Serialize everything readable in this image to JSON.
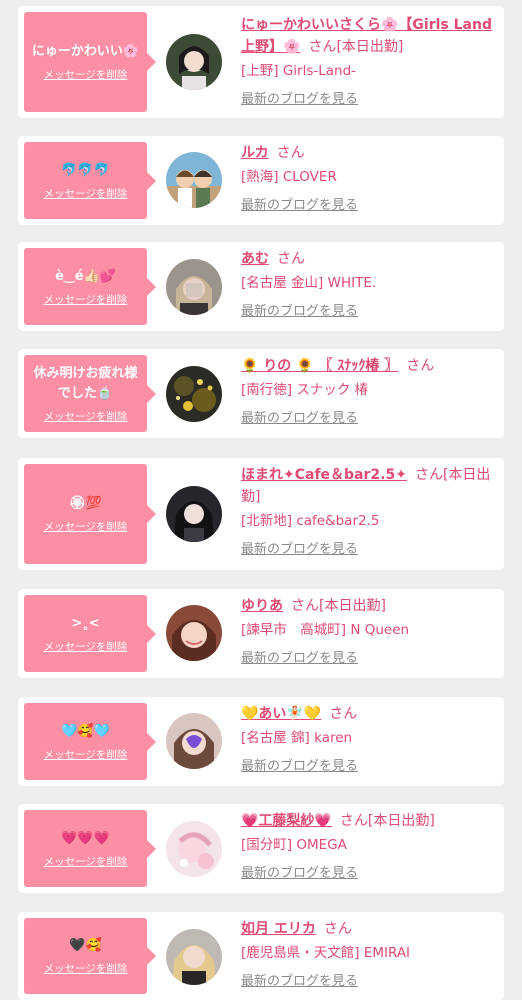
{
  "delete_label": "メッセージを削除",
  "san_label": "さん",
  "blog_label": "最新のブログを見る",
  "colors": {
    "accent": "#fd8fa4",
    "name": "#e04a73",
    "background": "#eeeeee",
    "card": "#ffffff",
    "link_gray": "#8a8a8a"
  },
  "entries": [
    {
      "message": "にゅーかわいい🌸",
      "name": "にゅーかわいいさくら🌸【Girls Land 上野】🌸",
      "status": "[本日出勤]",
      "shop": "[上野] Girls-Land-"
    },
    {
      "message": "🐬🐬🐬",
      "name": "ルカ",
      "status": "",
      "shop": "[熱海] CLOVER"
    },
    {
      "message": "è‿é👍🏻💕",
      "name": "あむ",
      "status": "",
      "shop": "[名古屋 金山] WHITE."
    },
    {
      "message": "休み明けお疲れ様でした🍵",
      "name": "🌻 りの 🌻 〖 ｽﾅｯｸ椿 〗",
      "status": "",
      "shop": "[南行徳] スナック 椿"
    },
    {
      "message": "🏵💯",
      "name": "ほまれ✦Cafe＆bar2.5✦",
      "status": "[本日出勤]",
      "shop": "[北新地] cafe&bar2.5"
    },
    {
      "message": ">˳<",
      "name": "ゆりあ",
      "status": "[本日出勤]",
      "shop": "[諫早市　高城町] N Queen"
    },
    {
      "message": "🩵🥰🩵",
      "name": "💛あい🧚🏻💛",
      "status": "",
      "shop": "[名古屋 錦] karen"
    },
    {
      "message": "💗💗💗",
      "name": "💗工藤梨紗💗",
      "status": "[本日出勤]",
      "shop": "[国分町] OMEGA"
    },
    {
      "message": "🖤🥰",
      "name": "如月 エリカ",
      "status": "",
      "shop": "[鹿児島県・天文館] EMIRAI"
    }
  ]
}
